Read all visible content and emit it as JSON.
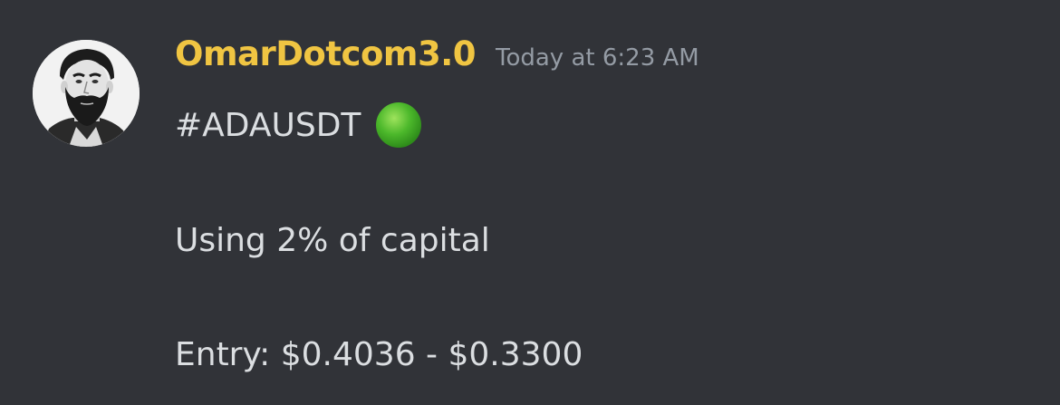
{
  "message": {
    "author": "OmarDotcom3.0",
    "timestamp": "Today at 6:23 AM",
    "lines": [
      "#ADAUSDT",
      "Using 2% of capital",
      "Entry: $0.4036 - $0.3300"
    ],
    "status_emoji": "green-circle-icon",
    "avatar_icon": "user-avatar-bearded-man"
  },
  "colors": {
    "background": "#313338",
    "username": "#f0c542",
    "timestamp": "#949ba4",
    "text": "#dbdee1",
    "emoji_green": "#43b02a"
  }
}
